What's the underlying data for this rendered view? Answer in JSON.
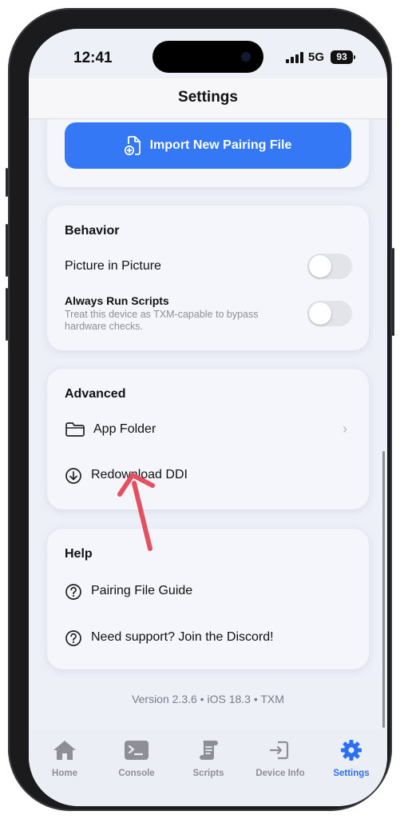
{
  "status": {
    "time": "12:41",
    "network": "5G",
    "battery": "93"
  },
  "header": {
    "title": "Settings"
  },
  "pairing": {
    "import_label": "Import New Pairing File"
  },
  "behavior": {
    "title": "Behavior",
    "pip_label": "Picture in Picture",
    "pip_enabled": false,
    "run_scripts_label": "Always Run Scripts",
    "run_scripts_sub": "Treat this device as TXM-capable to bypass hardware checks.",
    "run_scripts_enabled": false
  },
  "advanced": {
    "title": "Advanced",
    "app_folder_label": "App Folder",
    "redownload_label": "Redownload DDI"
  },
  "help": {
    "title": "Help",
    "guide_label": "Pairing File Guide",
    "discord_label": "Need support? Join the Discord!"
  },
  "footer": {
    "version": "Version 2.3.6 • iOS 18.3 • TXM"
  },
  "tabs": [
    {
      "label": "Home",
      "icon": "house-icon",
      "active": false
    },
    {
      "label": "Console",
      "icon": "terminal-icon",
      "active": false
    },
    {
      "label": "Scripts",
      "icon": "scroll-icon",
      "active": false
    },
    {
      "label": "Device Info",
      "icon": "device-info-icon",
      "active": false
    },
    {
      "label": "Settings",
      "icon": "gear-icon",
      "active": true
    }
  ],
  "colors": {
    "accent": "#3478f6",
    "annotation": "#e4505f"
  }
}
